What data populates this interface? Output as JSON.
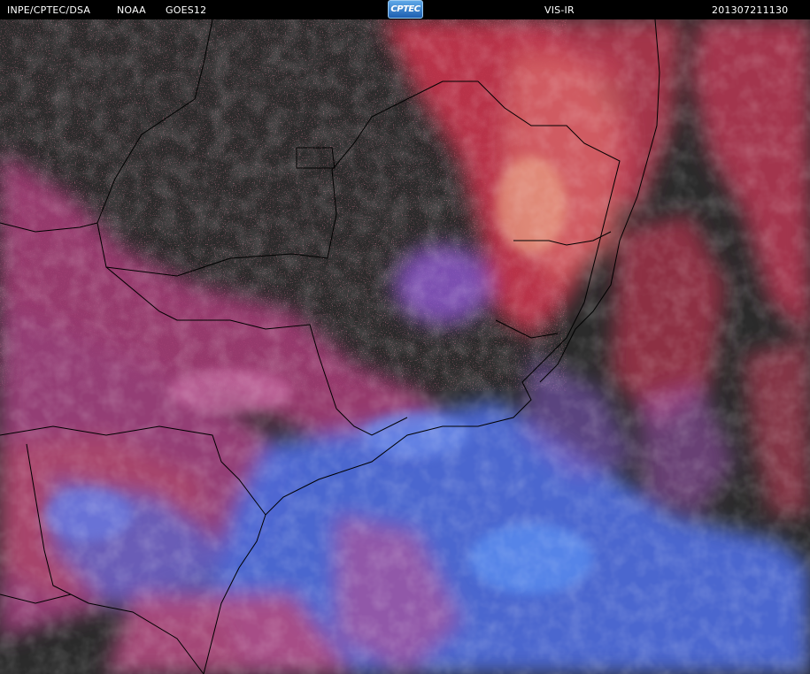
{
  "header": {
    "source": "INPE/CPTEC/DSA",
    "agency": "NOAA",
    "satellite": "GOES12",
    "logo_text": "CPTEC",
    "product": "VIS-IR",
    "timestamp": "201307211130"
  },
  "colors": {
    "background": "#2b2b2b",
    "header_bg": "#000000",
    "low_cloud": "#d03a55",
    "mid_cloud": "#a04a90",
    "high_cloud": "#4a6ad8",
    "border_lines": "#000000"
  },
  "icons": {
    "logo": "cptec-logo-icon"
  }
}
